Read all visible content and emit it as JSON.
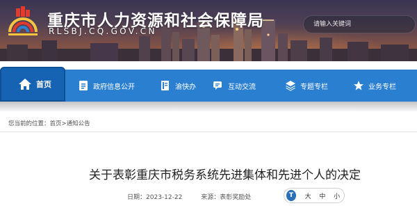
{
  "header": {
    "site_title": "重庆市人力资源和社会保障局",
    "site_url": "RLSBJ.CQ.GOV.CN",
    "search_placeholder": "请输入关键词"
  },
  "nav": {
    "items": [
      {
        "label": "首页",
        "icon": "home-icon",
        "active": true
      },
      {
        "label": "政府信息公开",
        "icon": "document-icon",
        "active": false
      },
      {
        "label": "渝快办",
        "icon": "book-icon",
        "active": false
      },
      {
        "label": "互动交流",
        "icon": "chat-icon",
        "active": false
      },
      {
        "label": "专题专栏",
        "icon": "layers-icon",
        "active": false
      },
      {
        "label": "业务专栏",
        "icon": "star-icon",
        "active": false
      }
    ]
  },
  "breadcrumb": {
    "prefix": "您当前的位置：",
    "home": "首页",
    "separator": ">",
    "current": "通知公告"
  },
  "article": {
    "title": "关于表彰重庆市税务系统先进集体和先进个人的决定",
    "date_label": "日期：",
    "date": "2023-12-22",
    "source_label": "来源：",
    "source": "表彰奖励处"
  },
  "font_size_control": {
    "badge": "T",
    "large": "大",
    "medium": "中",
    "small": "小"
  },
  "colors": {
    "nav_bg": "#2a7fd1",
    "nav_active": "#1662b3",
    "badge_bg": "#2a6fb8"
  }
}
